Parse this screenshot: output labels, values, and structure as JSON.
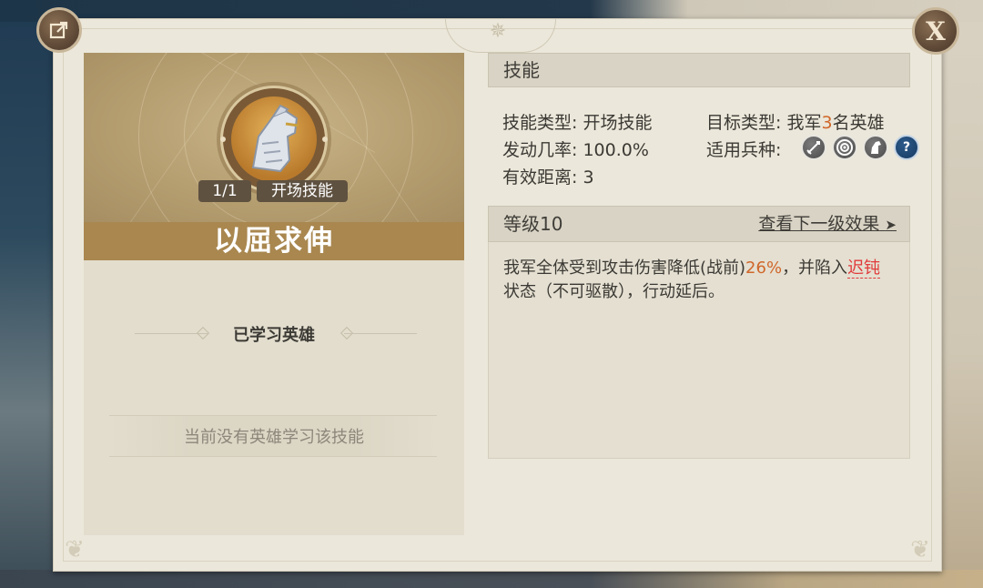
{
  "skill": {
    "name": "以屈求伸",
    "count_tag": "1/1",
    "type_tag": "开场技能"
  },
  "learned": {
    "title": "已学习英雄",
    "empty_text": "当前没有英雄学习该技能"
  },
  "skill_section": {
    "header": "技能",
    "skill_type_label": "技能类型:",
    "skill_type_value": "开场技能",
    "target_type_label": "目标类型:",
    "target_prefix": "我军",
    "target_count": "3",
    "target_suffix": "名英雄",
    "rate_label": "发动几率:",
    "rate_value": "100.0%",
    "unit_label": "适用兵种:",
    "units": [
      "sword-icon",
      "target-icon",
      "horse-icon",
      "help-icon"
    ],
    "range_label": "有效距离:",
    "range_value": "3"
  },
  "level_section": {
    "level": "等级10",
    "next_link": "查看下一级效果",
    "next_arrow": "➤"
  },
  "description": {
    "part1": "我军全体受到攻击伤害降低(战前)",
    "highlight_value": "26%",
    "part2": "，并陷入",
    "status": "迟钝",
    "part3": "状态（不可驱散），行动延后。"
  },
  "buttons": {
    "close_label": "X"
  },
  "colors": {
    "accent_orange": "#d0672a",
    "status_red": "#e1393a",
    "title_band": "#a9874f"
  }
}
